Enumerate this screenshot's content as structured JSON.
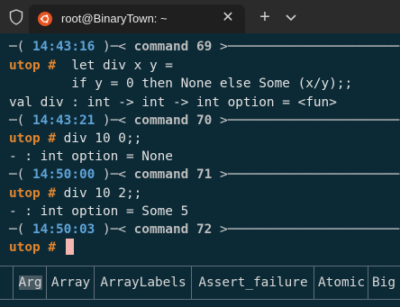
{
  "titlebar": {
    "tab_title": "root@BinaryTown: ~",
    "close_glyph": "✕",
    "new_tab_glyph": "+",
    "icons": [
      "shield-icon",
      "ubuntu-icon",
      "close-icon",
      "plus-icon",
      "chevron-down-icon"
    ]
  },
  "terminal": {
    "sep1": {
      "left": "─( ",
      "time": "14:43:16",
      "mid": " )─< ",
      "cmd": "command 69",
      "right": " >──────────────────────"
    },
    "in1": {
      "prompt": "utop #",
      "code": "  let div x y ="
    },
    "in1b": "        if y = 0 then None else Some (x/y);;",
    "out1": "val div : int -> int -> int option = <fun>",
    "sep2": {
      "left": "─( ",
      "time": "14:43:21",
      "mid": " )─< ",
      "cmd": "command 70",
      "right": " >──────────────────────"
    },
    "in2": {
      "prompt": "utop #",
      "code": " div 10 0;;"
    },
    "out2": "- : int option = None",
    "sep3": {
      "left": "─( ",
      "time": "14:50:00",
      "mid": " )─< ",
      "cmd": "command 71",
      "right": " >──────────────────────"
    },
    "in3": {
      "prompt": "utop #",
      "code": " div 10 2;;"
    },
    "out3": "- : int option = Some 5",
    "sep4": {
      "left": "─( ",
      "time": "14:50:03",
      "mid": " )─< ",
      "cmd": "command 72",
      "right": " >──────────────────────"
    },
    "in4": {
      "prompt": "utop #",
      "code": " "
    }
  },
  "completions": [
    "Arg",
    "Array",
    "ArrayLabels",
    "Assert_failure",
    "Atomic",
    "Big"
  ],
  "colors": {
    "background": "#0c2a36",
    "time": "#5fa3d8",
    "prompt": "#e2862f",
    "cursor": "#f4b6b1"
  }
}
